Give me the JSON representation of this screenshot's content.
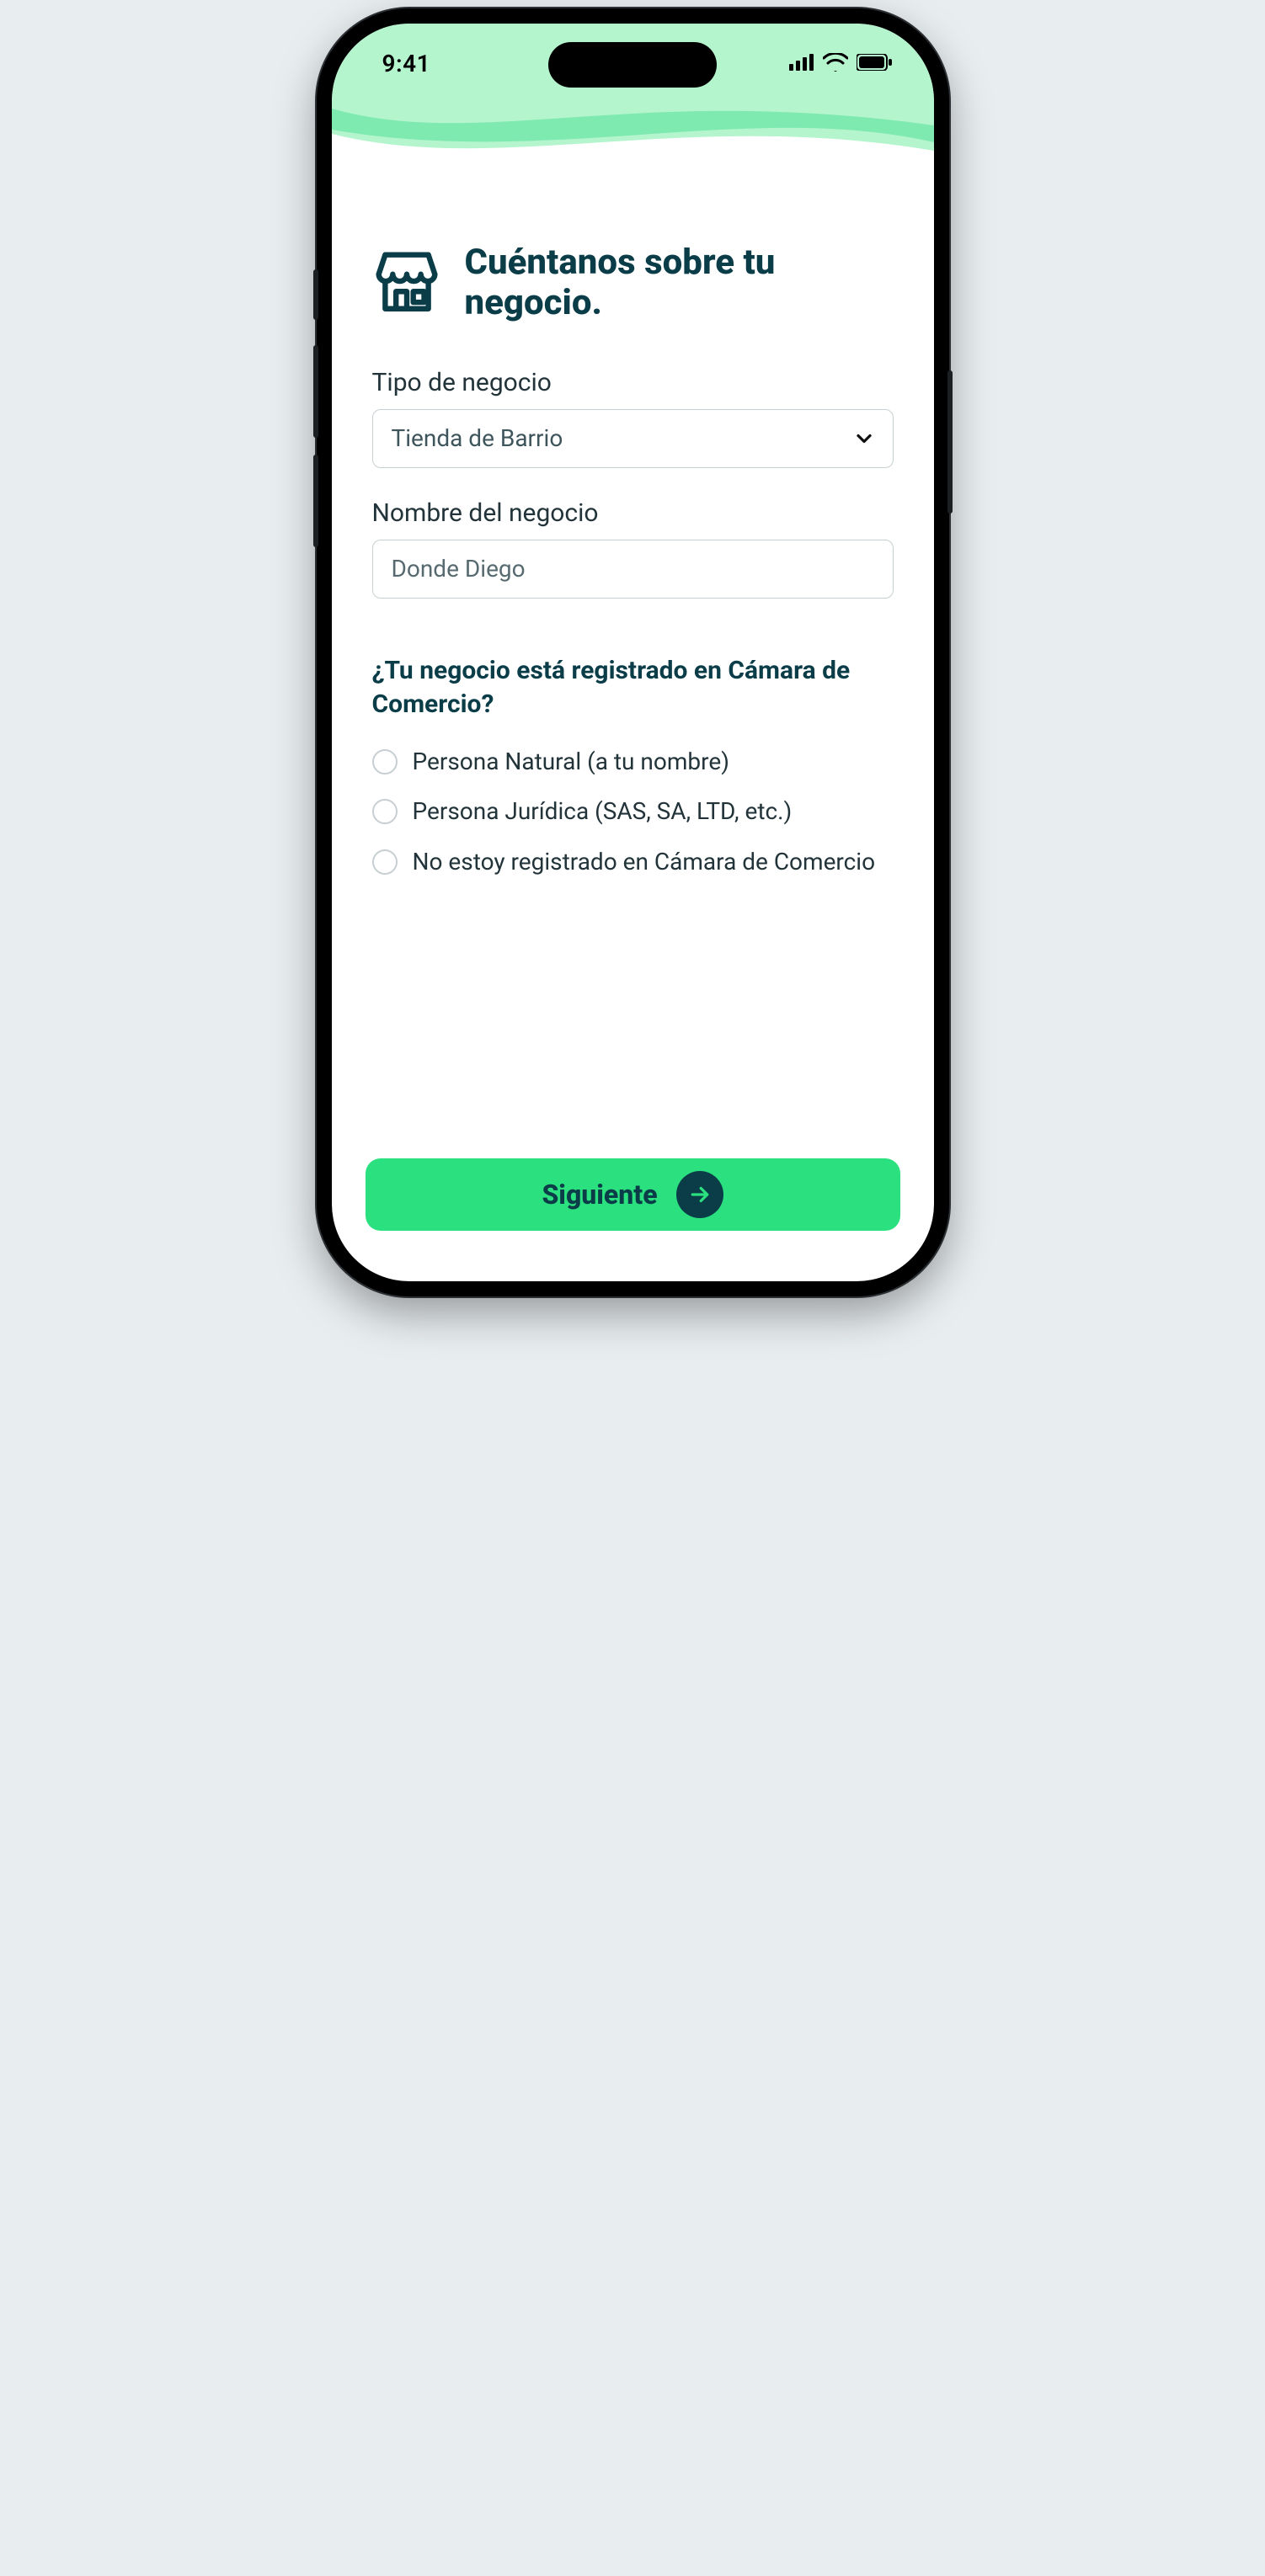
{
  "status_bar": {
    "time": "9:41"
  },
  "header": {
    "title": "Cuéntanos sobre tu negocio."
  },
  "form": {
    "business_type": {
      "label": "Tipo de negocio",
      "selected": "Tienda de Barrio"
    },
    "business_name": {
      "label": "Nombre del negocio",
      "value": "Donde Diego",
      "placeholder": "Donde Diego"
    },
    "registration_question": "¿Tu negocio está registrado en Cámara de Comercio?",
    "registration_options": [
      "Persona  Natural (a tu nombre)",
      "Persona Jurídica (SAS, SA, LTD, etc.)",
      "No estoy registrado en Cámara de Comercio"
    ]
  },
  "footer": {
    "next_label": "Siguiente"
  },
  "colors": {
    "primary_dark": "#0b3d49",
    "accent_green": "#2be07e",
    "wave_light": "#b5f5ce",
    "wave_mid": "#7eeab0"
  }
}
